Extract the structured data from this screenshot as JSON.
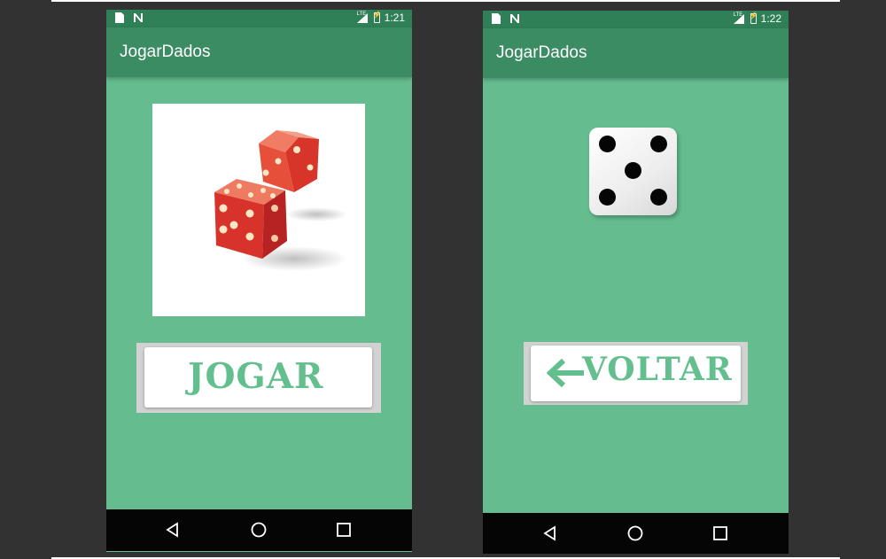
{
  "phones": [
    {
      "status": {
        "network": "LTE",
        "time": "1:21"
      },
      "app_title": "JogarDados",
      "image": "red-dice-image",
      "button": {
        "label": "JOGAR"
      }
    },
    {
      "status": {
        "network": "LTE",
        "time": "1:22"
      },
      "app_title": "JogarDados",
      "die_value": 5,
      "button": {
        "label": "VOLTAR",
        "icon": "arrow-left-icon"
      }
    }
  ],
  "colors": {
    "screen_bg": "#64bc8f",
    "appbar": "#3b8c63",
    "statusbar": "#2f7f57",
    "button_text": "#63bf8d",
    "navbar": "#050505"
  }
}
